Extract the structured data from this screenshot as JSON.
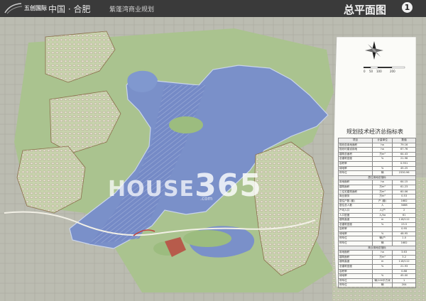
{
  "header": {
    "brand": "五创国际",
    "place": "中国 · 合肥",
    "project": "紫蓬湾商业规划",
    "map_title": "总平面图",
    "map_number": "1"
  },
  "scale_bar": {
    "labels": [
      "0",
      "50",
      "100",
      "200"
    ]
  },
  "watermark": {
    "main": "HOUSE",
    "accent": "365",
    "suffix": ".com"
  },
  "table": {
    "title": "规划技术经济总指标表",
    "headers": [
      "项目",
      "计量单位",
      "数值"
    ],
    "rows": [
      [
        "规划总用地面积",
        "ha",
        "79.16"
      ],
      [
        "规划可建设用地",
        "ha",
        "67.76"
      ],
      [
        "建筑总面积",
        "万m²",
        "64.43"
      ],
      [
        "总建筑密度",
        "%",
        "21.96"
      ],
      [
        "容积率",
        "",
        "0.951"
      ],
      [
        "绿地率",
        "%",
        "45.25"
      ],
      [
        "停车位",
        "辆",
        "2330.96"
      ]
    ],
    "sections": [
      {
        "title": "居住用地总指标",
        "rows": [
          [
            "用地面积",
            "ha",
            "64.15"
          ],
          [
            "建筑面积",
            "万m²",
            "61.23"
          ],
          [
            "三住宅建筑面积",
            "万m²",
            "60.06"
          ],
          [
            "商业服务",
            "万m²",
            "0.53"
          ],
          [
            "居住户数 (套)",
            "户 (套)",
            "1682"
          ],
          [
            "居住总人数",
            "人",
            "3488"
          ],
          [
            "户均人口",
            "人/户",
            "2"
          ],
          [
            "人口密度",
            "人/ha",
            "61"
          ],
          [
            "建筑高度",
            "m",
            "118/112"
          ],
          [
            "总建筑密度",
            "%",
            "23.5"
          ],
          [
            "容积率",
            "",
            "0.95"
          ],
          [
            "绿地率",
            "%",
            "48.95"
          ],
          [
            "停车位",
            "辆/户",
            "1.0"
          ],
          [
            "停车位",
            "辆",
            "1682"
          ]
        ]
      },
      {
        "title": "商业用地总指标",
        "rows": [
          [
            "用地面积",
            "ha",
            "3.63"
          ],
          [
            "建筑面积",
            "万m²",
            "3.2"
          ],
          [
            "建筑高度",
            "m",
            "118/112"
          ],
          [
            "总建筑密度",
            "%",
            "21.93"
          ],
          [
            "容积率",
            "",
            "0.88"
          ],
          [
            "绿地率",
            "%",
            "45.00"
          ],
          [
            "停车位",
            "辆/100平方米",
            "1"
          ],
          [
            "停车位",
            "辆",
            "204"
          ]
        ]
      }
    ]
  }
}
